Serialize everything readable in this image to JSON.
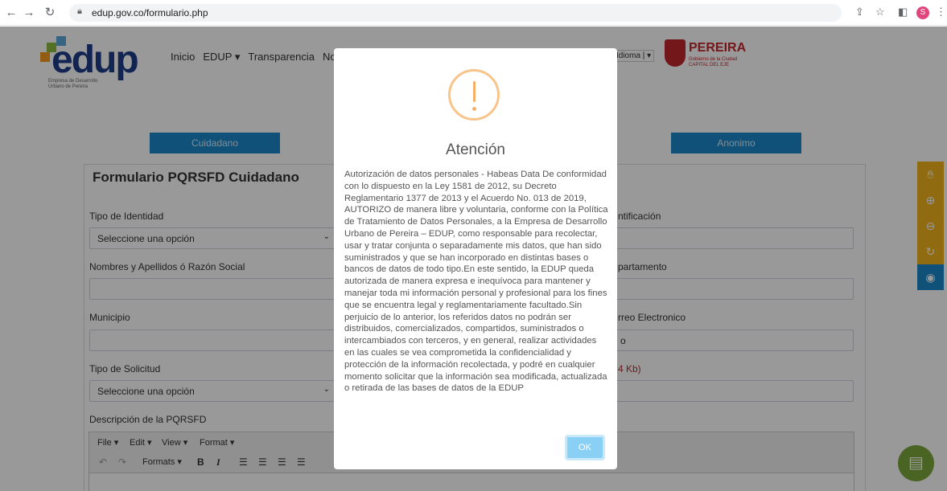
{
  "browser": {
    "url": "edup.gov.co/formulario.php",
    "profile_initial": "S"
  },
  "header": {
    "logo_text": "edup",
    "logo_sub": "Empresa de Desarrollo Urbano de Pereira",
    "nav": [
      "Inicio",
      "EDUP ▾",
      "Transparencia",
      "Noti"
    ],
    "idioma": "Idioma",
    "pereira_title": "PEREIRA",
    "pereira_sub": "Gobierno de la Ciudad CAPITAL DEL EJE"
  },
  "tabs": {
    "ciudadano": "Cuidadano",
    "anonimo": "Anonimo"
  },
  "form": {
    "title": "Formulario PQRSFD Cuidadano",
    "tipo_identidad_label": "Tipo de Identidad",
    "tipo_identidad_value": "Seleccione una opción",
    "identificacion_label": "ntificación",
    "nombres_label": "Nombres y Apellidos ó Razón Social",
    "departamento_label": "partamento",
    "municipio_label": "Municipio",
    "correo_label": "rreo Electronico",
    "correo_prefix": "o",
    "tipo_solicitud_label": "Tipo de Solicitud",
    "tipo_solicitud_value": "Seleccione una opción",
    "archivo_label": "4 Kb)",
    "descripcion_label": "Descripción de la PQRSFD",
    "editor_menus": [
      "File ▾",
      "Edit ▾",
      "View ▾",
      "Format ▾"
    ],
    "formats_label": "Formats ▾"
  },
  "modal": {
    "title": "Atención",
    "body": "Autorización de datos personales - Habeas Data De conformidad con lo dispuesto en la Ley 1581 de 2012, su Decreto Reglamentario 1377 de 2013 y el Acuerdo No. 013 de 2019, AUTORIZO de manera libre y voluntaria, conforme con la Política de Tratamiento de Datos Personales, a la Empresa de Desarrollo Urbano de Pereira – EDUP, como responsable para recolectar, usar y tratar conjunta o separadamente mis datos, que han sido suministrados y que se han incorporado en distintas bases o bancos de datos de todo tipo.En este sentido, la EDUP queda autorizada de manera expresa e inequívoca para mantener y manejar toda mi información personal y profesional para los fines que se encuentra legal y reglamentariamente facultado.Sin perjuicio de lo anterior, los referidos datos no podrán ser distribuidos, comercializados, compartidos, suministrados o intercambiados con terceros, y en general, realizar actividades en las cuales se vea comprometida la confidencialidad y protección de la información recolectada, y podré en cualquier momento solicitar que la información sea modificada, actualizada o retirada de las bases de datos de la EDUP",
    "ok_label": "OK"
  }
}
